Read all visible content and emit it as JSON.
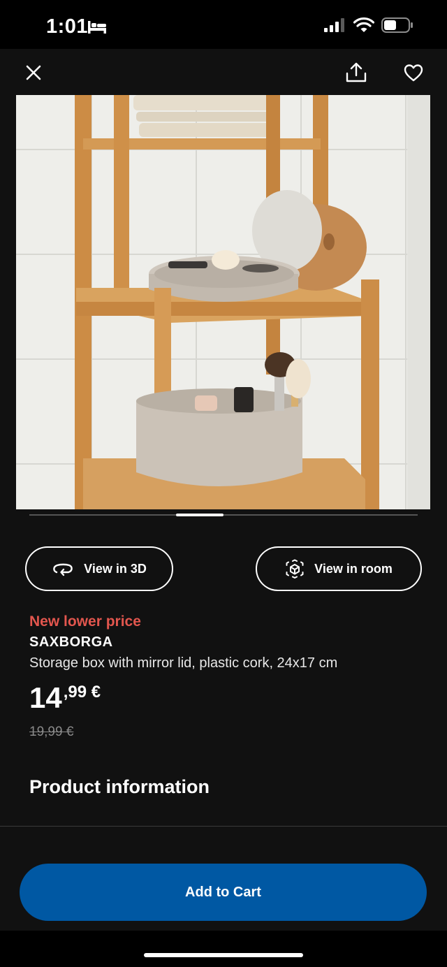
{
  "status_bar": {
    "time": "1:01",
    "battery_percent": 45
  },
  "nav": {
    "close_icon": "close-icon",
    "share_icon": "share-icon",
    "favorite_icon": "heart-icon"
  },
  "gallery": {
    "active_index": 2,
    "image": "product-photo"
  },
  "actions": {
    "view_3d_label": "View in 3D",
    "view_room_label": "View in room"
  },
  "product": {
    "price_tag": "New lower price",
    "name": "SAXBORGA",
    "description": "Storage box with mirror lid, plastic cork, 24x17 cm",
    "price_integer": "14",
    "price_decimal": ",99 €",
    "old_price": "19,99 €"
  },
  "section": {
    "title": "Product information"
  },
  "cart": {
    "label": "Add to Cart"
  },
  "colors": {
    "accent": "#0058a3",
    "sale": "#e2564e",
    "background": "#111111"
  }
}
